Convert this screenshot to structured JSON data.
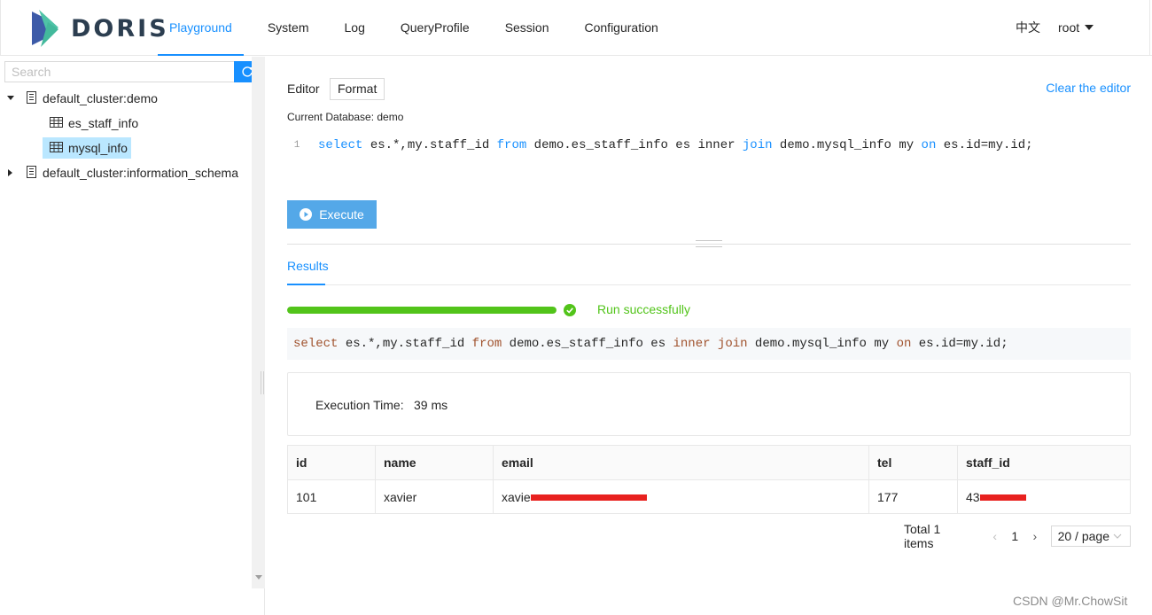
{
  "brand": {
    "name": "DORIS"
  },
  "nav": {
    "items": [
      {
        "label": "Playground",
        "active": true
      },
      {
        "label": "System"
      },
      {
        "label": "Log"
      },
      {
        "label": "QueryProfile"
      },
      {
        "label": "Session"
      },
      {
        "label": "Configuration"
      }
    ]
  },
  "header": {
    "language": "中文",
    "user": "root"
  },
  "sidebar": {
    "search_placeholder": "Search",
    "tree": [
      {
        "label": "default_cluster:demo",
        "expanded": true
      },
      {
        "label": "es_staff_info"
      },
      {
        "label": "mysql_info",
        "selected": true
      },
      {
        "label": "default_cluster:information_schema",
        "expanded": false
      }
    ]
  },
  "editor": {
    "label": "Editor",
    "format_label": "Format",
    "clear_label": "Clear the editor",
    "current_db": "Current Database: demo",
    "line_number": "1",
    "sql": {
      "p1": "select",
      "p2": " es.*,my.staff_id ",
      "p3": "from",
      "p4": " demo.es_staff_info es inner ",
      "p5": "join",
      "p6": " demo.mysql_info my ",
      "p7": "on",
      "p8": " es.id=my.id;"
    },
    "execute_label": "Execute"
  },
  "results": {
    "tab_label": "Results",
    "progress_percent": 100,
    "status": "Run successfully",
    "sql": {
      "p1": "select",
      "p2": " es.*,my.staff_id ",
      "p3": "from",
      "p4": " demo.es_staff_info es ",
      "p5": "inner",
      "p6": " ",
      "p7": "join",
      "p8": " demo.mysql_info my ",
      "p9": "on",
      "p10": " es.id=my.id;"
    },
    "exec_time_label": "Execution Time:",
    "exec_time_value": "39 ms",
    "columns": [
      "id",
      "name",
      "email",
      "tel",
      "staff_id"
    ],
    "rows": [
      {
        "id": "101",
        "name": "xavier",
        "email_prefix": "xavie",
        "tel": "177",
        "staff_id_prefix": "43"
      }
    ],
    "pagination": {
      "total": "Total 1 items",
      "page": "1",
      "page_size": "20 / page"
    }
  },
  "watermark": "CSDN @Mr.ChowSit",
  "colors": {
    "accent": "#1890ff",
    "success": "#52c41a",
    "redaction": "#e8211f"
  }
}
